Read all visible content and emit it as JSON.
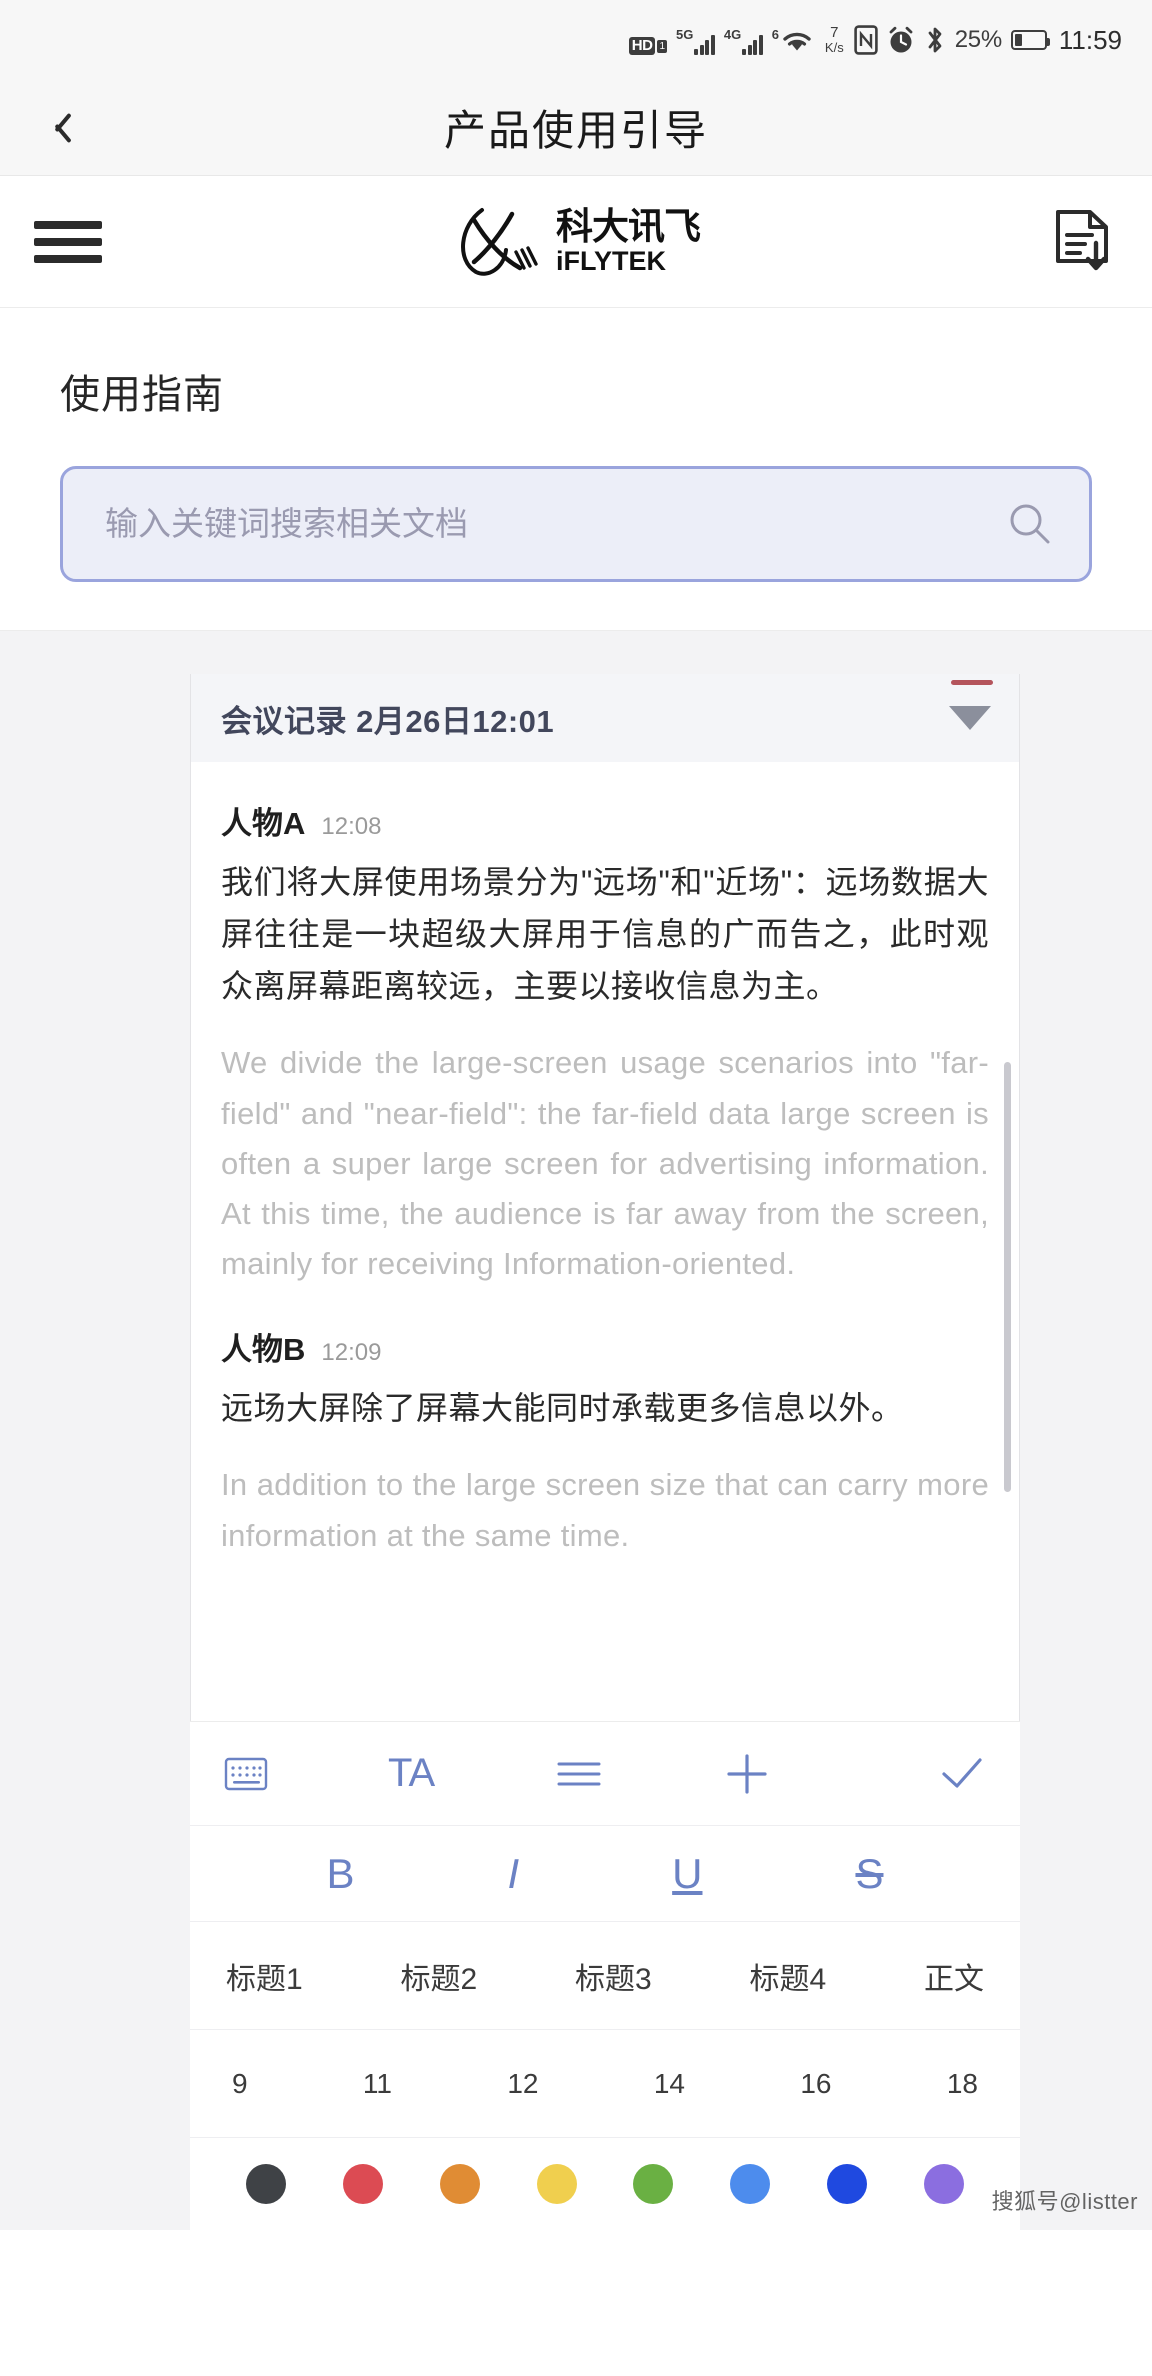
{
  "statusbar": {
    "hd_label": "HD",
    "hd_sub": "1",
    "net_5g": "5G",
    "net_4g": "4G",
    "wifi_sup": "6",
    "speed_value": "7",
    "speed_unit": "K/s",
    "nfc_icon": "nfc-icon",
    "alarm_icon": "alarm-icon",
    "bluetooth_icon": "bluetooth-icon",
    "battery_percent": "25%",
    "battery_level": 25,
    "clock": "11:59"
  },
  "titlebar": {
    "back_icon": "back-chevron-icon",
    "title": "产品使用引导"
  },
  "brandbar": {
    "menu_icon": "hamburger-menu-icon",
    "logo_cn": "科大讯飞",
    "logo_en": "iFLYTEK",
    "download_icon": "document-download-icon"
  },
  "guide": {
    "heading": "使用指南",
    "search": {
      "placeholder": "输入关键词搜索相关文档",
      "value": "",
      "icon": "search-icon"
    }
  },
  "document": {
    "header_title": "会议记录 2月26日12:01",
    "collapse_icon": "chevron-down-icon",
    "entries": [
      {
        "speaker": "人物A",
        "time": "12:08",
        "zh": "我们将大屏使用场景分为\"远场\"和\"近场\"：远场数据大屏往往是一块超级大屏用于信息的广而告之，此时观众离屏幕距离较远，主要以接收信息为主。",
        "en": "We divide the large-screen usage scenarios into \"far-field\" and \"near-field\": the far-field data large screen is often a super large screen for advertising information. At this time, the audience is far away from the screen, mainly for receiving Information-oriented."
      },
      {
        "speaker": "人物B",
        "time": "12:09",
        "zh": "远场大屏除了屏幕大能同时承载更多信息以外。",
        "en": "In addition to the large screen size that can carry more information at the same time."
      }
    ]
  },
  "toolbar": {
    "row1": [
      {
        "name": "keyboard-icon",
        "label": ""
      },
      {
        "name": "text-format-icon",
        "label": "TA"
      },
      {
        "name": "align-lines-icon",
        "label": ""
      },
      {
        "name": "add-plus-icon",
        "label": ""
      },
      {
        "name": "confirm-check-icon",
        "label": ""
      }
    ],
    "formats": [
      {
        "name": "bold-button",
        "label": "B"
      },
      {
        "name": "italic-button",
        "label": "I"
      },
      {
        "name": "underline-button",
        "label": "U"
      },
      {
        "name": "strikethrough-button",
        "label": "S"
      }
    ],
    "styles": [
      "标题1",
      "标题2",
      "标题3",
      "标题4",
      "正文"
    ],
    "sizes": [
      "9",
      "11",
      "12",
      "14",
      "16",
      "18"
    ],
    "colors": [
      "#3f4246",
      "#dc4b53",
      "#e08c34",
      "#f0cf4e",
      "#6ab043",
      "#4d8ced",
      "#1f49e0",
      "#8b6ee0"
    ]
  },
  "watermark": "搜狐号@listter"
}
